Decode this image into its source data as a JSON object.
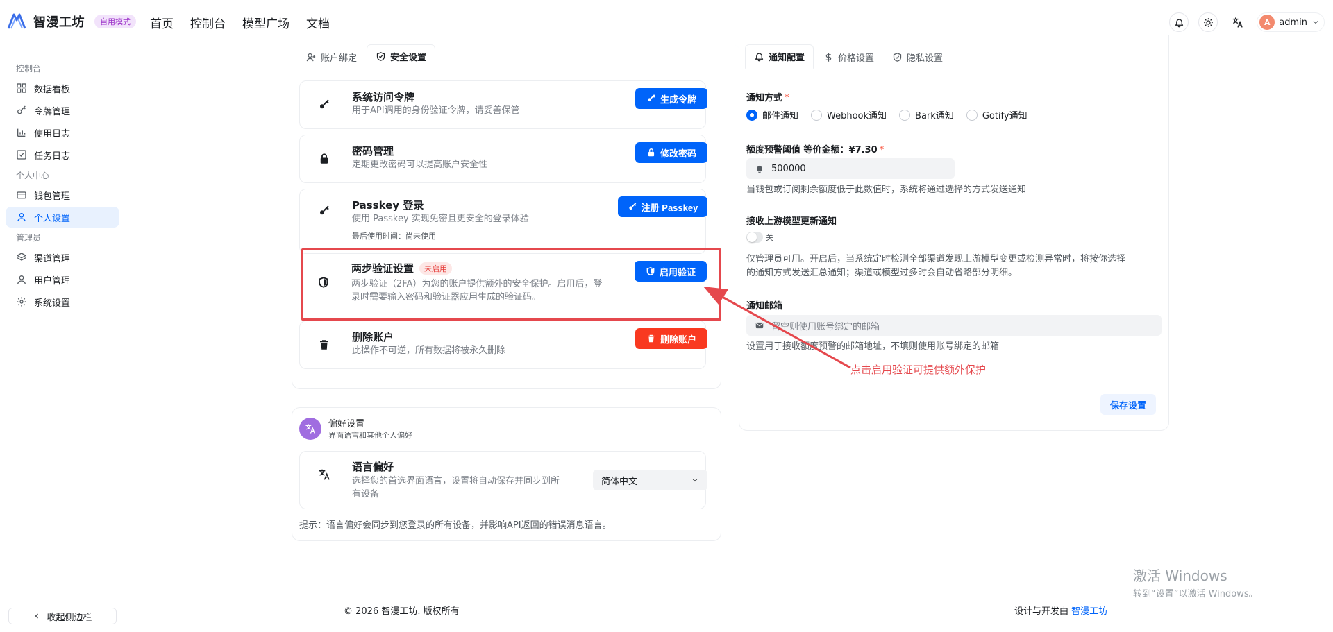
{
  "header": {
    "brand_name": "智漫工坊",
    "brand_badge": "自用模式",
    "nav": [
      "首页",
      "控制台",
      "模型广场",
      "文档"
    ],
    "user_initial": "A",
    "user_name": "admin"
  },
  "sidebar": {
    "groups": [
      {
        "label": "控制台",
        "items": [
          {
            "label": "数据看板",
            "icon": "dashboard-icon"
          },
          {
            "label": "令牌管理",
            "icon": "key-icon"
          },
          {
            "label": "使用日志",
            "icon": "bar-chart-icon"
          },
          {
            "label": "任务日志",
            "icon": "task-icon"
          }
        ]
      },
      {
        "label": "个人中心",
        "items": [
          {
            "label": "钱包管理",
            "icon": "wallet-icon"
          },
          {
            "label": "个人设置",
            "icon": "user-icon",
            "active": true
          }
        ]
      },
      {
        "label": "管理员",
        "items": [
          {
            "label": "渠道管理",
            "icon": "layers-icon"
          },
          {
            "label": "用户管理",
            "icon": "user-icon"
          },
          {
            "label": "系统设置",
            "icon": "gear-icon"
          }
        ]
      }
    ],
    "collapse_label": "收起侧边栏"
  },
  "security_card": {
    "tabs": [
      "账户绑定",
      "安全设置"
    ],
    "rows": [
      {
        "title": "系统访问令牌",
        "desc": "用于API调用的身份验证令牌，请妥善保管",
        "button": "生成令牌"
      },
      {
        "title": "密码管理",
        "desc": "定期更改密码可以提高账户安全性",
        "button": "修改密码"
      },
      {
        "title": "Passkey 登录",
        "desc": "使用 Passkey 实现免密且更安全的登录体验",
        "desc2": "最后使用时间：尚未使用",
        "button": "注册 Passkey"
      },
      {
        "title": "两步验证设置",
        "badge": "未启用",
        "desc": "两步验证（2FA）为您的账户提供额外的安全保护。启用后，登",
        "desc2": "录时需要输入密码和验证器应用生成的验证码。",
        "button": "启用验证"
      },
      {
        "title": "删除账户",
        "desc": "此操作不可逆，所有数据将被永久删除",
        "button": "删除账户"
      }
    ]
  },
  "pref_card": {
    "title": "偏好设置",
    "subtitle": "界面语言和其他个人偏好",
    "lang_title": "语言偏好",
    "lang_desc1": "选择您的首选界面语言，设置将自动保存并同步到所",
    "lang_desc2": "有设备",
    "lang_value": "简体中文",
    "tip": "提示：语言偏好会同步到您登录的所有设备，并影响API返回的错误消息语言。"
  },
  "notify_card": {
    "tabs": [
      "通知配置",
      "价格设置",
      "隐私设置"
    ],
    "method_label": "通知方式",
    "methods": [
      "邮件通知",
      "Webhook通知",
      "Bark通知",
      "Gotify通知"
    ],
    "selected_method": 0,
    "threshold_label": "额度预警阈值 等价金额：¥7.30",
    "threshold_value": "500000",
    "threshold_hint": "当钱包或订阅剩余额度低于此数值时，系统将通过选择的方式发送通知",
    "upstream_label": "接收上游模型更新通知",
    "toggle_text": "关",
    "upstream_hint1": "仅管理员可用。开启后，当系统定时检测全部渠道发现上游模型变更或检测异常时，将按你选择",
    "upstream_hint2": "的通知方式发送汇总通知；渠道或模型过多时会自动省略部分明细。",
    "email_label": "通知邮箱",
    "email_placeholder": "留空则使用账号绑定的邮箱",
    "email_hint": "设置用于接收额度预警的邮箱地址，不填则使用账号绑定的邮箱",
    "save_label": "保存设置"
  },
  "annotation": {
    "text": "点击启用验证可提供额外保护",
    "color": "#e5484d"
  },
  "footer": {
    "copyright": "© 2026 智漫工坊. 版权所有",
    "design_prefix": "设计与开发由",
    "design_link": "智漫工坊"
  },
  "watermark": {
    "line1": "激活 Windows",
    "line2": "转到“设置”以激活 Windows。"
  },
  "colors": {
    "primary": "#0064fa",
    "danger": "#f93920",
    "active_bg": "#e8f1fe"
  }
}
